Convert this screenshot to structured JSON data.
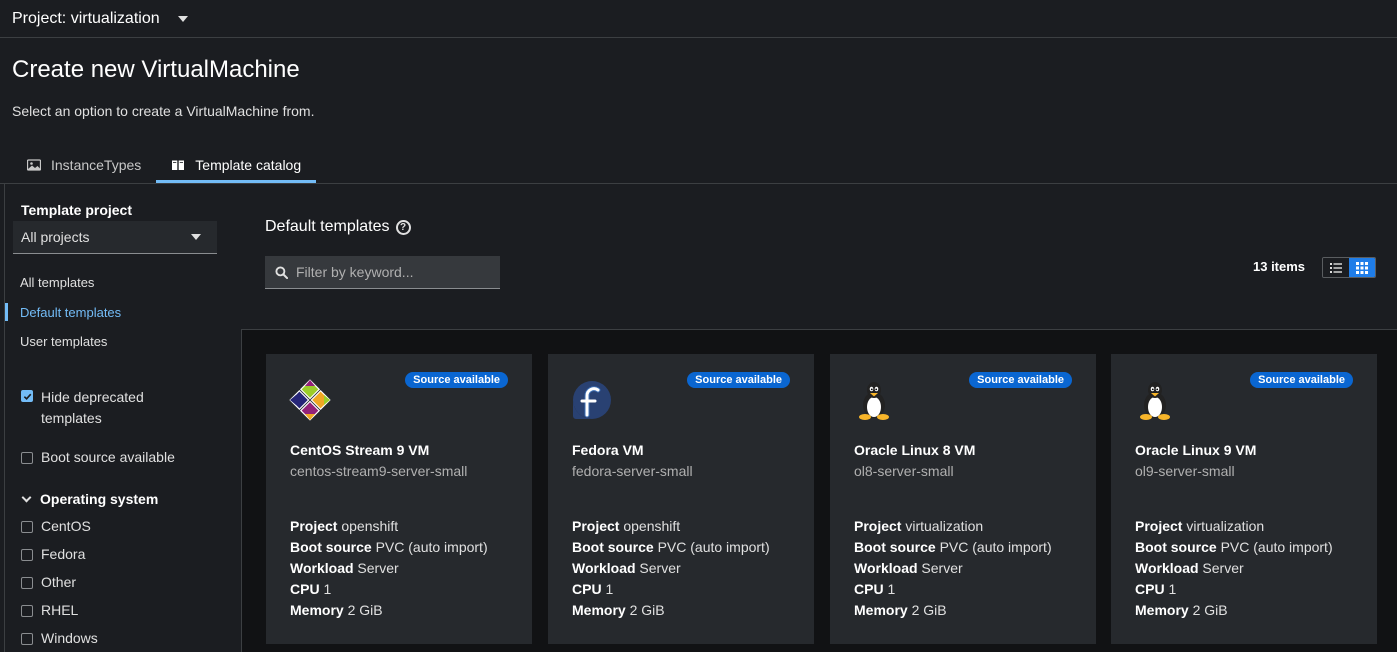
{
  "project_bar": {
    "label": "Project: virtualization"
  },
  "page": {
    "title": "Create new VirtualMachine",
    "subtitle": "Select an option to create a VirtualMachine from."
  },
  "tabs": [
    {
      "label": "InstanceTypes",
      "icon": "image-icon"
    },
    {
      "label": "Template catalog",
      "icon": "book-icon"
    }
  ],
  "sidebar": {
    "filter_title": "Template project",
    "project_select": "All projects",
    "nav": [
      "All templates",
      "Default templates",
      "User templates"
    ],
    "hide_deprecated": "Hide deprecated templates",
    "hide_deprecated_line1": "Hide deprecated",
    "hide_deprecated_line2": "templates",
    "boot_source": "Boot source available",
    "os_group": "Operating system",
    "os_options": [
      "CentOS",
      "Fedora",
      "Other",
      "RHEL",
      "Windows"
    ]
  },
  "main": {
    "section_title": "Default templates",
    "search_placeholder": "Filter by keyword...",
    "items_count": "13 items"
  },
  "labels": {
    "project": "Project",
    "boot_source": "Boot source",
    "workload": "Workload",
    "cpu": "CPU",
    "memory": "Memory"
  },
  "cards": [
    {
      "badge": "Source available",
      "title": "CentOS Stream 9 VM",
      "name": "centos-stream9-server-small",
      "project": "openshift",
      "boot_source": "PVC (auto import)",
      "workload": "Server",
      "cpu": "1",
      "memory": "2 GiB",
      "logo": "centos-logo-icon"
    },
    {
      "badge": "Source available",
      "title": "Fedora VM",
      "name": "fedora-server-small",
      "project": "openshift",
      "boot_source": "PVC (auto import)",
      "workload": "Server",
      "cpu": "1",
      "memory": "2 GiB",
      "logo": "fedora-logo-icon"
    },
    {
      "badge": "Source available",
      "title": "Oracle Linux 8 VM",
      "name": "ol8-server-small",
      "project": "virtualization",
      "boot_source": "PVC (auto import)",
      "workload": "Server",
      "cpu": "1",
      "memory": "2 GiB",
      "logo": "tux-logo-icon"
    },
    {
      "badge": "Source available",
      "title": "Oracle Linux 9 VM",
      "name": "ol9-server-small",
      "project": "virtualization",
      "boot_source": "PVC (auto import)",
      "workload": "Server",
      "cpu": "1",
      "memory": "2 GiB",
      "logo": "tux-logo-icon"
    }
  ],
  "colors": {
    "accent": "#73bcf7",
    "badge": "#0a66d1",
    "background": "#1b1d21",
    "card": "#26292d"
  }
}
